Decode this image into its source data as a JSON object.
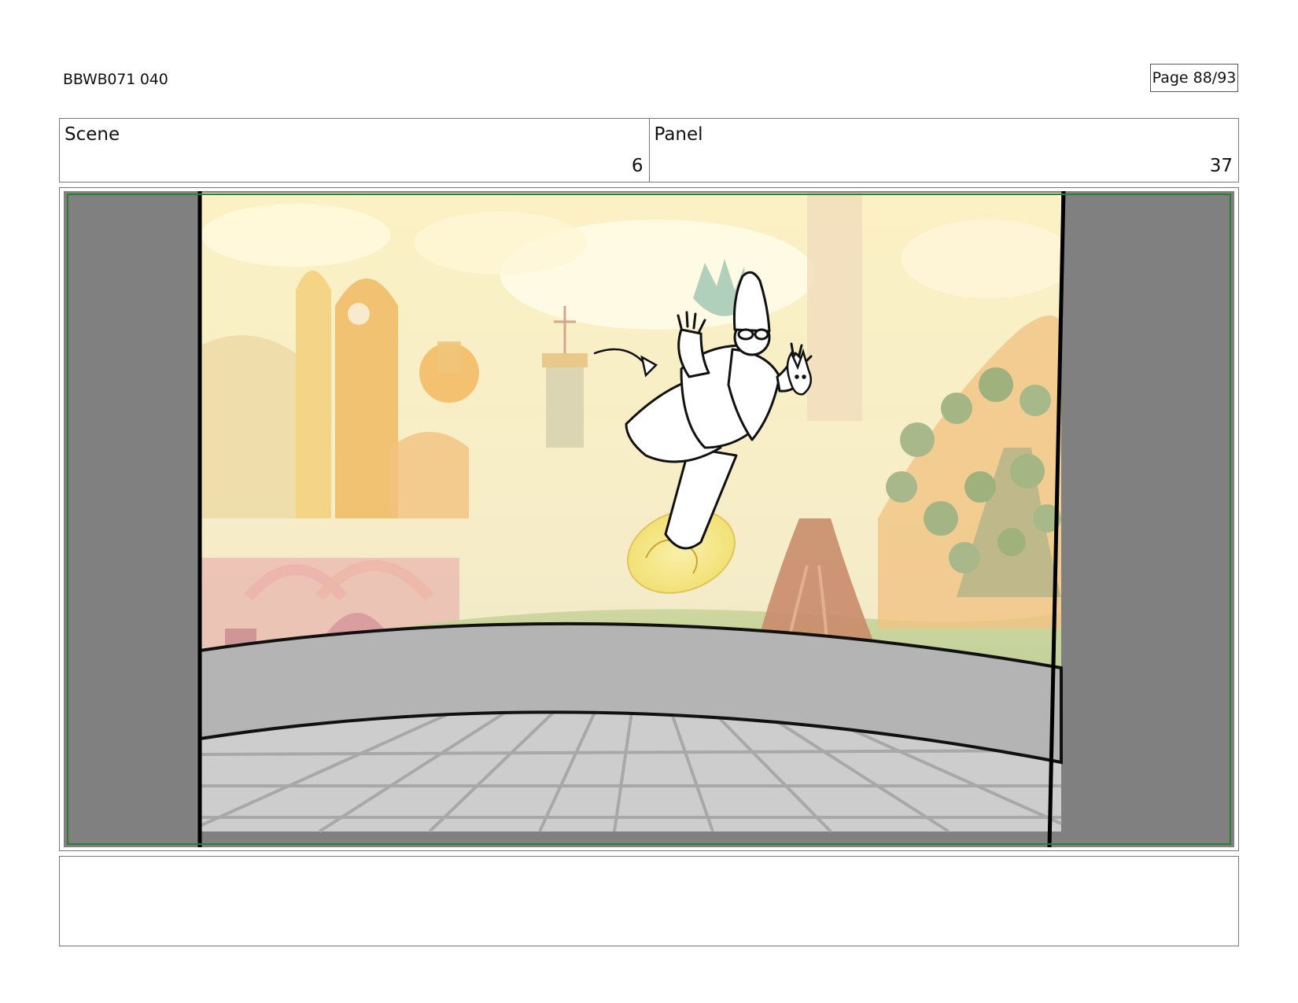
{
  "header": {
    "doc_id": "BBWB071 040",
    "page_label": "Page 88/93"
  },
  "info": {
    "scene_label": "Scene",
    "scene_value": "6",
    "panel_label": "Panel",
    "panel_value": "37"
  },
  "panel": {
    "artwork": "storyboard-drawing-wizard-on-flying-disc",
    "colors": {
      "safe_frame": "#2e7d32",
      "side_wall": "#808080",
      "railing": "#b3b3b3",
      "floor": "#cfcfcf",
      "floor_lines": "#a8a8a8",
      "sky": "#fbf3c9",
      "disc_glow": "#f4e36a"
    }
  },
  "notes": {
    "text": ""
  }
}
